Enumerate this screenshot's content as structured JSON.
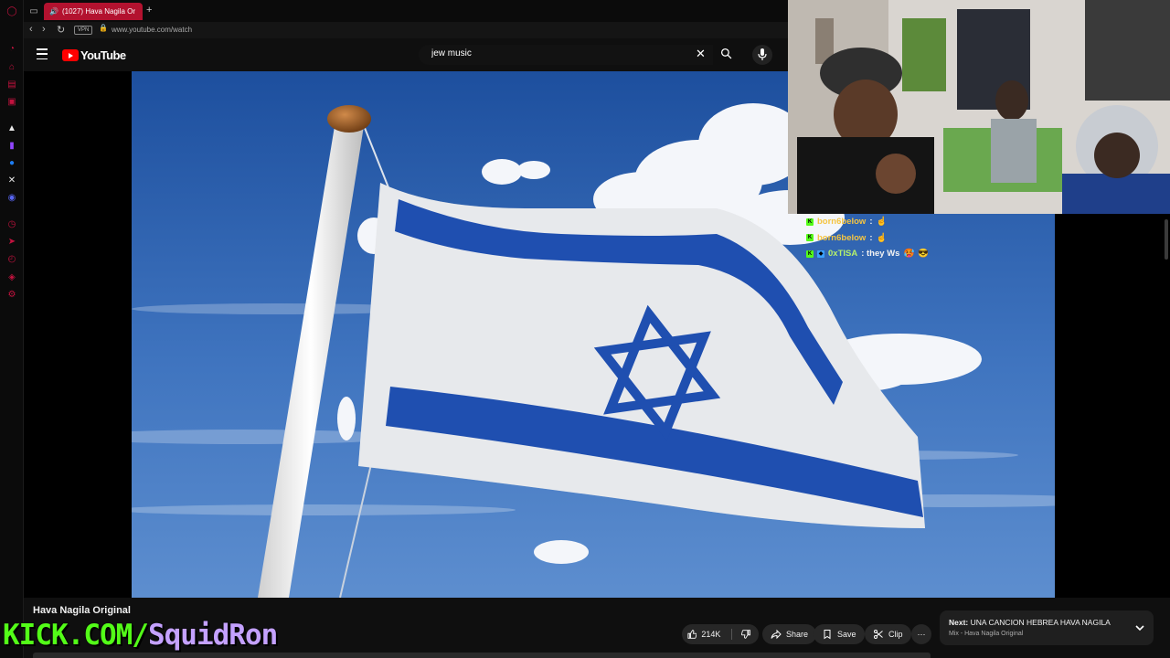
{
  "browser": {
    "tab_count_title": "(1027) Hava Nagila Or",
    "new_tab_symbol": "+",
    "vpn_label": "VPN",
    "url": "www.youtube.com/watch"
  },
  "youtube": {
    "logo_text": "YouTube",
    "search_query": "jew music",
    "clear_symbol": "✕"
  },
  "chat": [
    {
      "user": "born6below",
      "message": ":"
    },
    {
      "user": "born6below",
      "message": ":"
    },
    {
      "user": "0xTISA",
      "message": ": they Ws"
    }
  ],
  "video": {
    "title": "Hava Nagila Original",
    "likes": "214K",
    "share_label": "Share",
    "save_label": "Save",
    "clip_label": "Clip",
    "more_symbol": "⋯"
  },
  "next_up": {
    "prefix": "Next:",
    "title": "UNA CANCION HEBREA HAVA NAGILA",
    "subtitle": "Mix - Hava Nagila Original"
  },
  "watermark": {
    "part1": "KICK.COM/",
    "part2": "SquidRon"
  },
  "colors": {
    "accent_red": "#b3122f",
    "youtube_red": "#ff0000",
    "kick_green": "#53fc18",
    "flag_blue": "#1f4fb0"
  }
}
